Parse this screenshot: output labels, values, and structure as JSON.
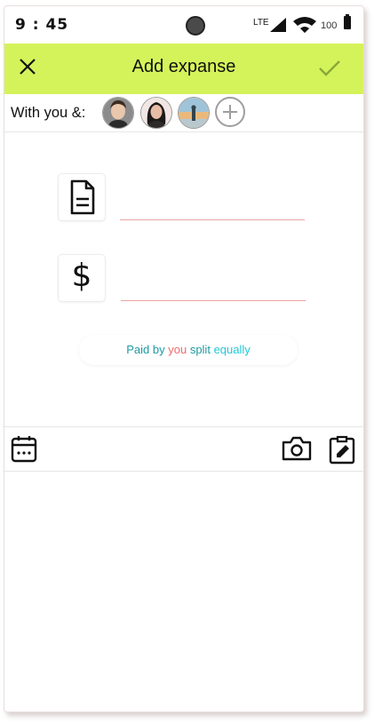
{
  "status_bar": {
    "time": "9 : 45",
    "network": "LTE",
    "battery": "100"
  },
  "app_bar": {
    "title": "Add expanse",
    "close_icon": "close-icon",
    "confirm_icon": "checkmark-icon"
  },
  "members": {
    "label": "With you &:",
    "avatars": [
      "avatar-person-1",
      "avatar-person-2",
      "avatar-person-3"
    ],
    "add_icon": "add-circle-icon"
  },
  "form": {
    "description": {
      "icon": "document-icon",
      "value": "",
      "placeholder": ""
    },
    "amount": {
      "icon": "dollar-icon",
      "symbol": "$",
      "value": "",
      "placeholder": ""
    }
  },
  "split": {
    "paid_by": "Paid by",
    "payer": "you",
    "split": "split",
    "mode": "equally"
  },
  "toolbar": {
    "calendar_icon": "calendar-icon",
    "camera_icon": "camera-icon",
    "note_icon": "edit-note-icon"
  },
  "colors": {
    "app_bar": "#d4f35a",
    "accent_teal": "#1e9aa3",
    "accent_red": "#f06a6a",
    "accent_cyan": "#22c8d8",
    "underline": "#e9a3a3"
  }
}
